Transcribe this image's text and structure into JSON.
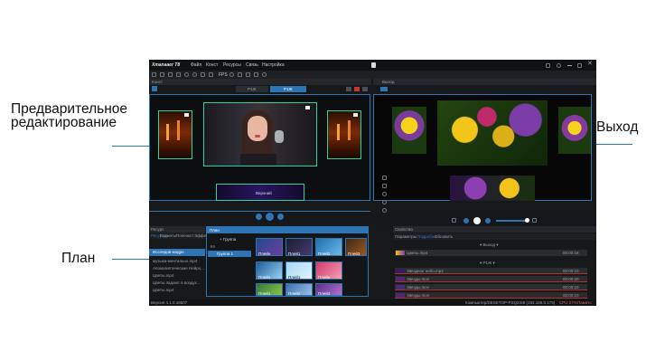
{
  "annotations": {
    "editing_line1": "Предварительное",
    "editing_line2": "редактирование",
    "output": "Выход",
    "plan": "План"
  },
  "app": {
    "logo": "Xmanaaer T8",
    "menu": [
      "Файл",
      "Конст",
      "Ресурсы",
      "Связь",
      "Настройка"
    ],
    "toolbar_fps": "FPS"
  },
  "edit": {
    "title": "Конст",
    "tabs": [
      "Р1Ж",
      "Р1Ж"
    ],
    "overlay_label": "Верхний"
  },
  "output": {
    "title": "Выход"
  },
  "resources": {
    "title": "Ресурс",
    "tabs": [
      "Ресурсы",
      "Гаджеты",
      "Полеэкст",
      "Эффе"
    ],
    "items": [
      "Исследов модрн",
      "музыка-ментальнo.mp4",
      "Апокалиптические Нейро...",
      "Цветы.mp4",
      "Цветы падают в воздух...",
      "Цветы.mp4"
    ]
  },
  "plan": {
    "title": "План",
    "add_group": "Группа",
    "tree": [
      "Кл",
      "Группа 1"
    ],
    "thumbs": [
      "Плейн",
      "Плей1",
      "Плей2",
      "Плей3",
      "Плей1",
      "Плей1",
      "Плейн",
      "Плей1",
      "Плей2",
      "Плей3",
      "Плей1",
      "Плей1"
    ]
  },
  "properties": {
    "title": "Свойства",
    "tabs": [
      "Параметры",
      "Подробно",
      "Обновить"
    ],
    "section_output": "Выход",
    "section_rlj": "Р1Ж",
    "rows": [
      {
        "name": "Цветы.mp4",
        "time": "00:00:18"
      },
      {
        "name": "Звездное небо.mp4",
        "time": "00:00:10"
      },
      {
        "name": "Звезды.mov",
        "time": "00:00:20"
      },
      {
        "name": "Звезды.mov",
        "time": "00:00:10"
      },
      {
        "name": "Звезды.mov",
        "time": "00:00:10"
      }
    ]
  },
  "status": {
    "version": "Версия 4.1.0.16607",
    "machine": "Компьютер/DESKTOP-PSQ2IS9 (192.168.0.179)",
    "cpu": "CPU 27%",
    "mem": "Память"
  },
  "colors": {
    "accent": "#2e75b6",
    "app_bg": "#17181a",
    "panel": "#202225"
  }
}
